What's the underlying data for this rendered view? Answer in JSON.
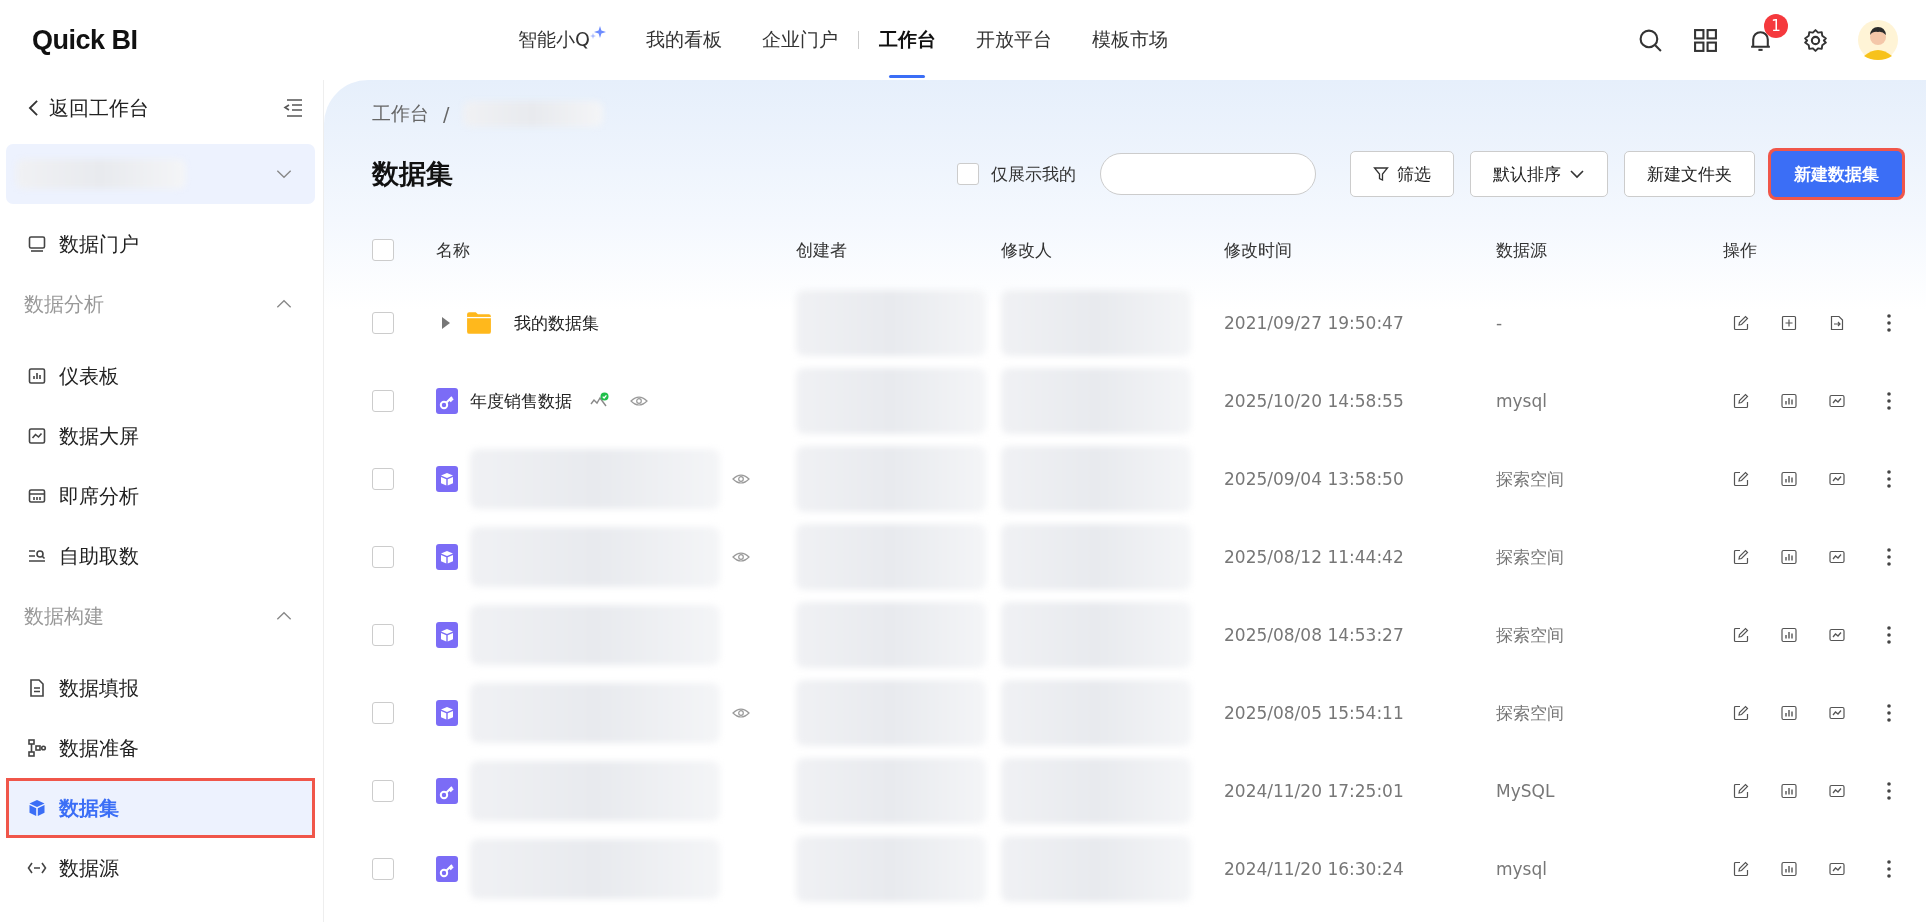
{
  "header": {
    "logo": "Quick BI",
    "nav": [
      {
        "label": "智能小Q",
        "kind": "ai",
        "selected": false
      },
      {
        "label": "我的看板",
        "kind": "plain",
        "selected": false
      },
      {
        "label": "企业门户",
        "kind": "plain",
        "selected": false
      },
      {
        "label": "工作台",
        "kind": "plain",
        "selected": true
      },
      {
        "label": "开放平台",
        "kind": "plain",
        "selected": false
      },
      {
        "label": "模板市场",
        "kind": "plain",
        "selected": false
      }
    ],
    "notifications": "1"
  },
  "sidebar": {
    "back": "返回工作台",
    "items": [
      {
        "kind": "link",
        "label": "数据门户",
        "selected": false,
        "highlighted": false
      },
      {
        "kind": "group",
        "label": "数据分析",
        "expanded": true,
        "children": [
          {
            "label": "仪表板",
            "selected": false,
            "highlighted": false
          },
          {
            "label": "数据大屏",
            "selected": false,
            "highlighted": false
          },
          {
            "label": "即席分析",
            "selected": false,
            "highlighted": false
          },
          {
            "label": "自助取数",
            "selected": false,
            "highlighted": false
          }
        ]
      },
      {
        "kind": "group",
        "label": "数据构建",
        "expanded": true,
        "children": [
          {
            "label": "数据填报",
            "selected": false,
            "highlighted": false
          },
          {
            "label": "数据准备",
            "selected": false,
            "highlighted": false
          },
          {
            "label": "数据集",
            "selected": true,
            "highlighted": true
          },
          {
            "label": "数据源",
            "selected": false,
            "highlighted": false
          }
        ]
      }
    ]
  },
  "page": {
    "breadcrumb": [
      "工作台"
    ],
    "breadcrumb_separator": "/",
    "title": "数据集",
    "only_mine": {
      "label": "仅展示我的",
      "checked": false
    },
    "buttons": [
      {
        "label": "筛选",
        "kind": "filter",
        "highlighted": false
      },
      {
        "label": "默认排序",
        "kind": "sort",
        "highlighted": false
      },
      {
        "label": "新建文件夹",
        "kind": "plain",
        "highlighted": false
      },
      {
        "label": "新建数据集",
        "kind": "primary",
        "highlighted": true
      }
    ]
  },
  "table": {
    "select_all": {
      "checked": false
    },
    "columns": [
      "名称",
      "创建者",
      "修改人",
      "修改时间",
      "数据源",
      "操作"
    ],
    "rows": [
      {
        "kind": "folder",
        "name": "我的数据集",
        "expanded": false,
        "certified": false,
        "preview": false,
        "modified": "2021/09/27 19:50:47",
        "source": "-",
        "checked": false
      },
      {
        "kind": "key",
        "name": "年度销售数据",
        "certified": true,
        "preview": true,
        "modified": "2025/10/20 14:58:55",
        "source": "mysql",
        "checked": false
      },
      {
        "kind": "cube",
        "certified": false,
        "preview": true,
        "modified": "2025/09/04 13:58:50",
        "source": "探索空间",
        "checked": false
      },
      {
        "kind": "cube",
        "certified": false,
        "preview": true,
        "modified": "2025/08/12 11:44:42",
        "source": "探索空间",
        "checked": false
      },
      {
        "kind": "cube",
        "certified": false,
        "preview": false,
        "modified": "2025/08/08 14:53:27",
        "source": "探索空间",
        "checked": false
      },
      {
        "kind": "cube",
        "certified": false,
        "preview": true,
        "modified": "2025/08/05 15:54:11",
        "source": "探索空间",
        "checked": false
      },
      {
        "kind": "key",
        "certified": false,
        "preview": false,
        "modified": "2024/11/20 17:25:01",
        "source": "MySQL",
        "checked": false
      },
      {
        "kind": "key",
        "certified": false,
        "preview": false,
        "modified": "2024/11/20 16:30:24",
        "source": "mysql",
        "checked": false
      }
    ]
  }
}
